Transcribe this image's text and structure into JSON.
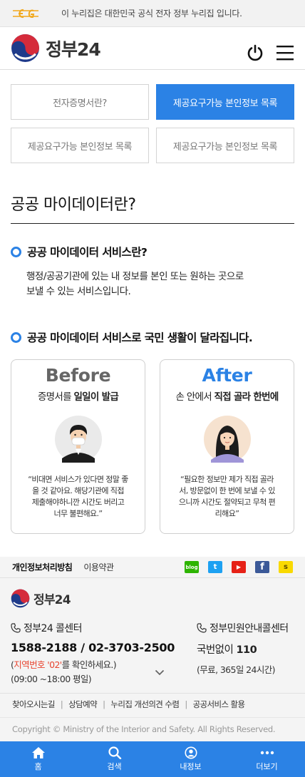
{
  "banner": {
    "text": "이 누리집은 대한민국 공식 전자 정부 누리집 입니다."
  },
  "header": {
    "logo_text": "정부24"
  },
  "tabs": [
    {
      "label": "전자증명서란?"
    },
    {
      "label": "제공요구가능 본인정보 목록"
    },
    {
      "label": "제공요구가능 본인정보 목록"
    },
    {
      "label": "제공요구가능 본인정보 목록"
    }
  ],
  "page": {
    "title": "공공 마이데이터란?"
  },
  "section1": {
    "heading": "공공 마이데이터 서비스란?",
    "desc_line1": "행정/공공기관에 있는 내 정보를 본인 또는 원하는 곳으로",
    "desc_line2": "보낼 수 있는 서비스입니다."
  },
  "section2": {
    "heading": "공공 마이데이터 서비스로 국민 생활이 달라집니다."
  },
  "before": {
    "word": "Before",
    "sub_prefix": "증명서를 ",
    "sub_bold": "일일이 발급",
    "quote_l1": "“비대면 서비스가 있다면 정말 좋",
    "quote_l2": "을 것 같아요. 해당기관에 직접",
    "quote_l3": "제출해야하니깐 시간도 버리고",
    "quote_l4": "너무 불편해요.”"
  },
  "after": {
    "word": "After",
    "sub_prefix": "손 안에서 ",
    "sub_bold": "직접 골라 한번에",
    "quote_l1": "“필요한 정보만 제가 직접 골라",
    "quote_l2": "서, 방문없이 한 번에 보낼 수 있",
    "quote_l3": "으니까 시간도 절약되고 무척 편",
    "quote_l4": "리해요”"
  },
  "footer_links": {
    "privacy": "개인정보처리방침",
    "terms": "이용약관"
  },
  "sns": [
    {
      "icon": "naver-blog-icon",
      "label": "blog",
      "color": "#2db400"
    },
    {
      "icon": "twitter-icon",
      "label": "t",
      "color": "#1da1f2"
    },
    {
      "icon": "youtube-icon",
      "label": "▶",
      "color": "#e62117"
    },
    {
      "icon": "facebook-icon",
      "label": "f",
      "color": "#3b5998"
    },
    {
      "icon": "kakao-story-icon",
      "label": "s",
      "color": "#f9d900"
    }
  ],
  "footer": {
    "logo_text": "정부24",
    "cc1_title": "정부24 콜센터",
    "cc1_number": "1588-2188 / 02-3703-2500",
    "cc1_note_open": "(",
    "cc1_note_red": "지역번호 '02'",
    "cc1_note_rest": "를 확인하세요.)",
    "cc1_hours": "(09:00 ~18:00 평일)",
    "cc2_title": "정부민원안내콜센터",
    "cc2_prefix": "국번없이 ",
    "cc2_number": "110",
    "cc2_note": "(무료, 365일 24시간)",
    "menu": [
      "찾아오시는길",
      "상담예약",
      "누리집 개선의견 수렴",
      "공공서비스 활용"
    ],
    "copyright": "Copyright © Ministry of the Interior and Safety. All Rights Reserved."
  },
  "bottom_nav": [
    {
      "label": "홈",
      "icon": "home-icon"
    },
    {
      "label": "검색",
      "icon": "search-icon"
    },
    {
      "label": "내정보",
      "icon": "user-icon"
    },
    {
      "label": "더보기",
      "icon": "more-icon"
    }
  ],
  "colors": {
    "primary": "#2b82e5",
    "highlight_red": "#e8442f"
  }
}
